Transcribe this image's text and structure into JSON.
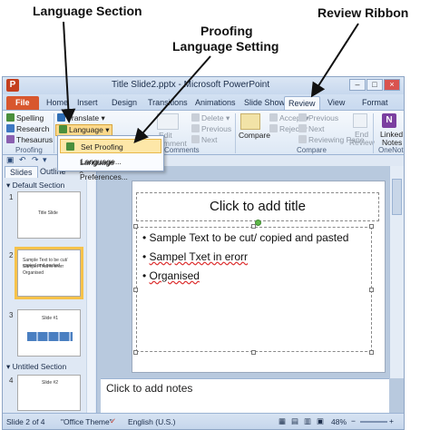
{
  "annotations": {
    "language_section": "Language Section",
    "proofing_line1": "Proofing",
    "proofing_line2": "Language Setting",
    "review_ribbon": "Review Ribbon"
  },
  "window": {
    "title": "Title Slide2.pptx - Microsoft PowerPoint",
    "app_badge": "P"
  },
  "tabs": {
    "file": "File",
    "home": "Home",
    "insert": "Insert",
    "design": "Design",
    "transitions": "Transitions",
    "animations": "Animations",
    "slide_show": "Slide Show",
    "review": "Review",
    "view": "View",
    "format": "Format"
  },
  "ribbon": {
    "spelling": "Spelling",
    "research": "Research",
    "thesaurus": "Thesaurus",
    "proofing_group": "Proofing",
    "translate": "Translate",
    "language": "Language",
    "comments_group": "Comments",
    "edit": "Edit",
    "comment": "Comment",
    "delete": "Delete",
    "previous": "Previous",
    "next": "Next",
    "compare": "Compare",
    "accept": "Accept",
    "reject": "Reject",
    "reviewing_pane": "Reviewing Pane",
    "end_review": "End",
    "review_word": "Review",
    "compare_group": "Compare",
    "linked_notes_line1": "Linked",
    "linked_notes_line2": "Notes",
    "onenote_group": "OneNote"
  },
  "dropdown": {
    "set_proofing": "Set Proofing Language...",
    "language_prefs": "Language Preferences..."
  },
  "left_pane": {
    "tab_slides": "Slides",
    "tab_outline": "Outline",
    "default_section": "Default Section",
    "untitled_section": "Untitled Section",
    "thumb1_num": "1",
    "thumb1_text": "Title Slide",
    "thumb2_num": "2",
    "thumb2_lines": [
      "Sample Text to be cut/ copied and pasted",
      "Sampel Txet in erorr",
      "Organised"
    ],
    "thumb3_num": "3",
    "thumb3_text": "Slide #1",
    "thumb4_num": "4",
    "thumb4_text": "Slide #2"
  },
  "slide": {
    "title": "Click to add title",
    "bullets": [
      "Sample Text to be cut/ copied and pasted",
      "Sampel Txet in erorr",
      "Organised"
    ]
  },
  "notes": {
    "placeholder": "Click to add notes"
  },
  "status": {
    "slide": "Slide 2 of 4",
    "theme": "\"Office Theme\"",
    "language": "English (U.S.)",
    "zoom": "48%"
  }
}
